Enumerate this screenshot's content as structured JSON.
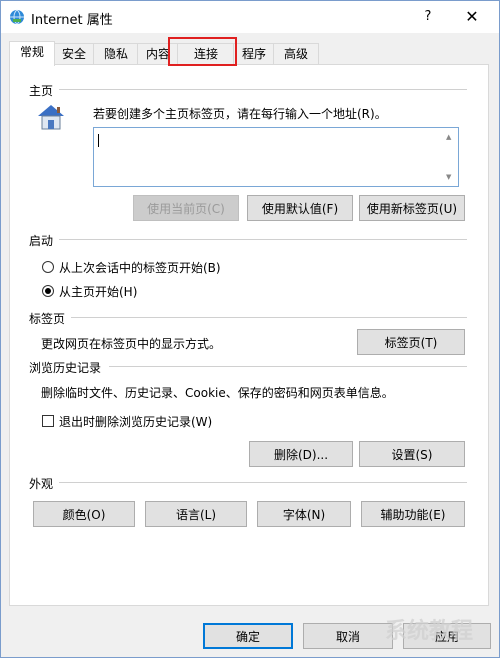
{
  "window": {
    "title": "Internet 属性",
    "help_label": "?",
    "close_label": "✕"
  },
  "tabs": [
    {
      "label": "常规",
      "active": true
    },
    {
      "label": "安全",
      "active": false
    },
    {
      "label": "隐私",
      "active": false
    },
    {
      "label": "内容",
      "active": false
    },
    {
      "label": "连接",
      "active": false
    },
    {
      "label": "程序",
      "active": false
    },
    {
      "label": "高级",
      "active": false
    }
  ],
  "home": {
    "section_title": "主页",
    "description": "若要创建多个主页标签页，请在每行输入一个地址(R)。",
    "address_value": "",
    "buttons": {
      "use_current": "使用当前页(C)",
      "use_default": "使用默认值(F)",
      "use_new_tab": "使用新标签页(U)"
    }
  },
  "startup": {
    "section_title": "启动",
    "options": [
      {
        "label": "从上次会话中的标签页开始(B)",
        "checked": false
      },
      {
        "label": "从主页开始(H)",
        "checked": true
      }
    ]
  },
  "tabs_section": {
    "section_title": "标签页",
    "description": "更改网页在标签页中的显示方式。",
    "button": "标签页(T)"
  },
  "history": {
    "section_title": "浏览历史记录",
    "description": "删除临时文件、历史记录、Cookie、保存的密码和网页表单信息。",
    "checkbox_label": "退出时删除浏览历史记录(W)",
    "checkbox_checked": false,
    "delete_button": "删除(D)...",
    "settings_button": "设置(S)"
  },
  "appearance": {
    "section_title": "外观",
    "buttons": [
      "颜色(O)",
      "语言(L)",
      "字体(N)",
      "辅助功能(E)"
    ]
  },
  "footer": {
    "ok": "确定",
    "cancel": "取消",
    "apply": "应用"
  },
  "watermark_text": "系统教程",
  "colors": {
    "highlight": "#e02020",
    "focus_border": "#0078d7",
    "input_border": "#7aa7d6"
  }
}
